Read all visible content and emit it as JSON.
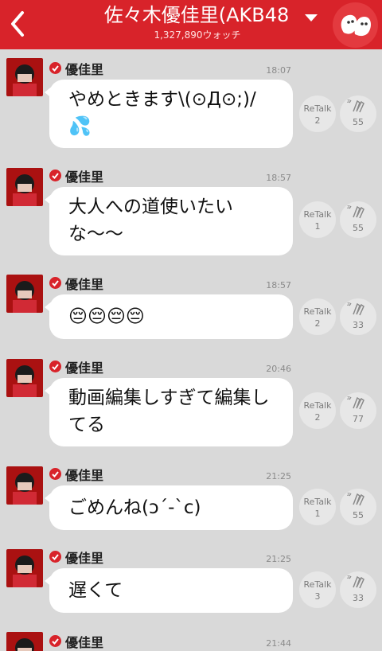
{
  "header": {
    "title": "佐々木優佳里(AKB48",
    "watch_count": "1,327,890ウォッチ"
  },
  "posts": [
    {
      "name": "優佳里",
      "time": "18:07",
      "lines": [
        "やめときます\\(⊙Д⊙;)/",
        "💦"
      ],
      "retalk_label": "ReTalk",
      "retalk_count": "2",
      "clap_count": "55"
    },
    {
      "name": "優佳里",
      "time": "18:57",
      "lines": [
        "大人への道使いたい",
        "な〜〜"
      ],
      "retalk_label": "ReTalk",
      "retalk_count": "1",
      "clap_count": "55"
    },
    {
      "name": "優佳里",
      "time": "18:57",
      "lines": [
        "😔😔😔😔"
      ],
      "retalk_label": "ReTalk",
      "retalk_count": "2",
      "clap_count": "33"
    },
    {
      "name": "優佳里",
      "time": "20:46",
      "lines": [
        "動画編集しすぎて編集し",
        "てる"
      ],
      "retalk_label": "ReTalk",
      "retalk_count": "2",
      "clap_count": "77"
    },
    {
      "name": "優佳里",
      "time": "21:25",
      "lines": [
        "ごめんね(ɔ´-`c)"
      ],
      "retalk_label": "ReTalk",
      "retalk_count": "1",
      "clap_count": "55"
    },
    {
      "name": "優佳里",
      "time": "21:25",
      "lines": [
        "遅くて"
      ],
      "retalk_label": "ReTalk",
      "retalk_count": "3",
      "clap_count": "33"
    },
    {
      "name": "優佳里",
      "time": "21:44",
      "lines": [],
      "retalk_label": "",
      "retalk_count": "",
      "clap_count": ""
    }
  ]
}
